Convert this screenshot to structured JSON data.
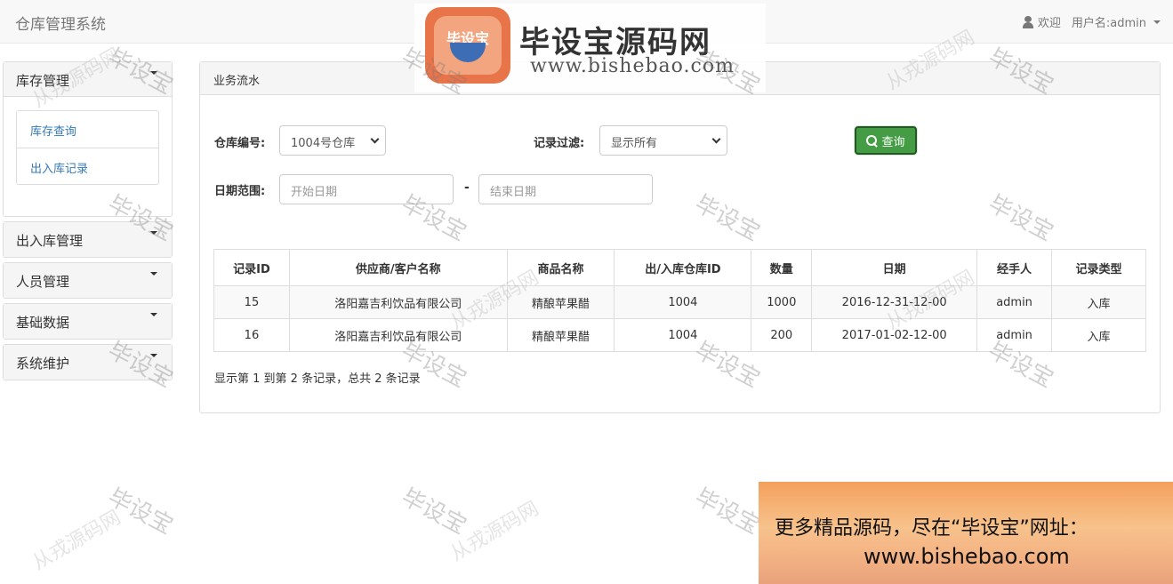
{
  "navbar": {
    "brand": "仓库管理系统",
    "welcome": "欢迎",
    "username_label": "用户名:admin"
  },
  "sidebar": {
    "menus": [
      {
        "label": "库存管理",
        "expanded": true,
        "items": [
          "库存查询",
          "出入库记录"
        ]
      },
      {
        "label": "出入库管理",
        "expanded": false
      },
      {
        "label": "人员管理",
        "expanded": false
      },
      {
        "label": "基础数据",
        "expanded": false
      },
      {
        "label": "系统维护",
        "expanded": false
      }
    ]
  },
  "main": {
    "title": "业务流水",
    "filters": {
      "warehouse_label": "仓库编号:",
      "warehouse_value": "1004号仓库",
      "record_filter_label": "记录过滤:",
      "record_filter_value": "显示所有",
      "query_button": "查询",
      "date_range_label": "日期范围:",
      "start_placeholder": "开始日期",
      "separator": "-",
      "end_placeholder": "结束日期"
    },
    "table": {
      "headers": [
        "记录ID",
        "供应商/客户名称",
        "商品名称",
        "出/入库仓库ID",
        "数量",
        "日期",
        "经手人",
        "记录类型"
      ],
      "rows": [
        [
          "15",
          "洛阳嘉吉利饮品有限公司",
          "精酿苹果醋",
          "1004",
          "1000",
          "2016-12-31-12-00",
          "admin",
          "入库"
        ],
        [
          "16",
          "洛阳嘉吉利饮品有限公司",
          "精酿苹果醋",
          "1004",
          "200",
          "2017-01-02-12-00",
          "admin",
          "入库"
        ]
      ]
    },
    "summary": "显示第 1 到第 2 条记录，总共 2 条记录"
  },
  "watermark": {
    "logo_badge": "毕设宝",
    "logo_title": "毕设宝源码网",
    "logo_url": "www.bishebao.com",
    "tag": "毕设宝",
    "tag2": "从戎源码网"
  },
  "promo": {
    "line1": "更多精品源码，尽在“毕设宝”网址：",
    "line2": "www.bishebao.com"
  },
  "colors": {
    "primary_link": "#337ab7",
    "success_button": "#449d44"
  }
}
